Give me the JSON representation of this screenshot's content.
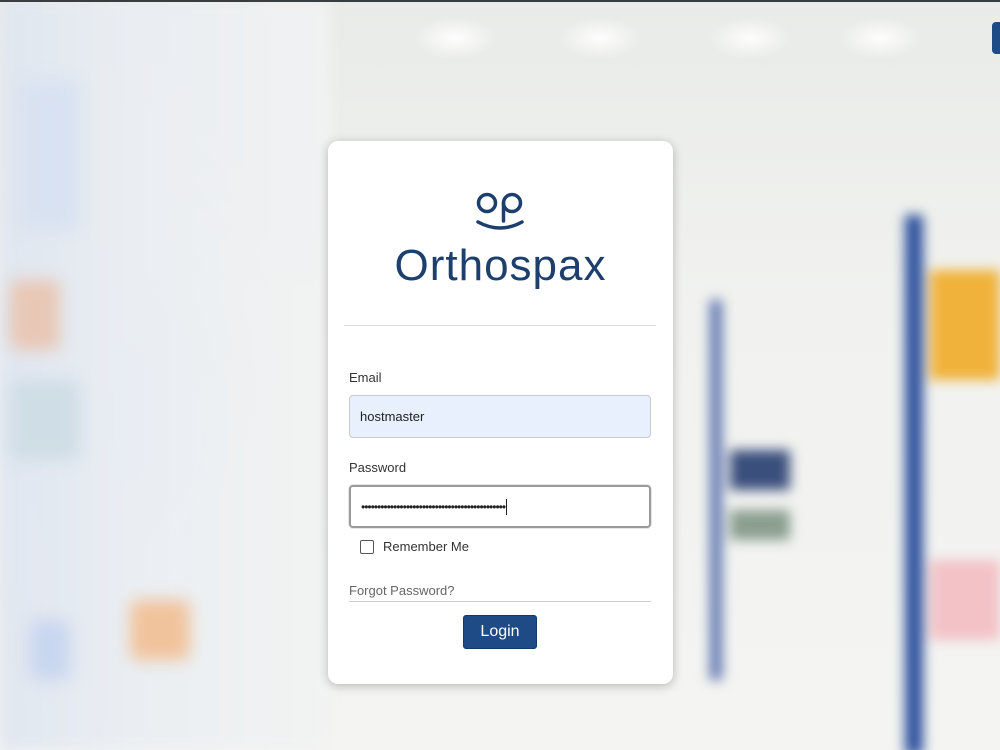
{
  "brand": {
    "name": "Orthospax",
    "logo_mark": "op"
  },
  "form": {
    "email_label": "Email",
    "email_value": "hostmaster",
    "password_label": "Password",
    "password_mask": "•••••••••••••••••••••••••••••••••••••••••••••",
    "remember_label": "Remember Me",
    "remember_checked": false,
    "forgot_link": "Forgot Password?",
    "login_button": "Login"
  },
  "colors": {
    "brand_navy": "#1d3f6e",
    "button_bg": "#1e4a86",
    "email_autofill_bg": "#e8f0fe"
  }
}
